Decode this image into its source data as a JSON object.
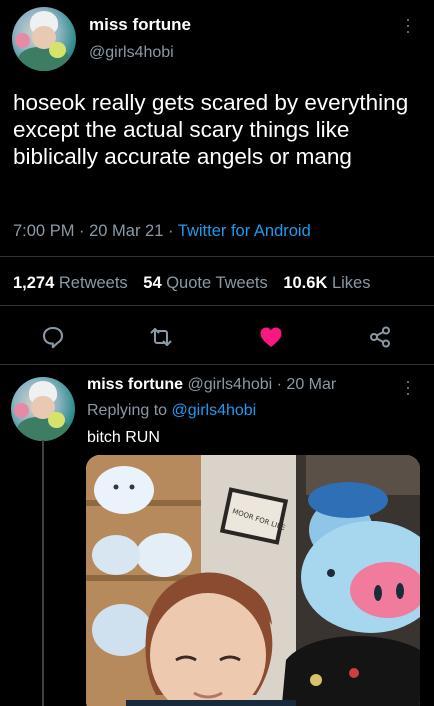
{
  "tweet": {
    "author_name": "miss fortune",
    "author_handle": "@girls4hobi",
    "text": "hoseok really gets scared by everything except the actual scary things like biblically accurate angels or mang",
    "time": "7:00 PM · 20 Mar 21 · ",
    "source": "Twitter for Android",
    "retweets_count": "1,274",
    "retweets_label": "Retweets",
    "quote_count": "54",
    "quote_label": "Quote Tweets",
    "likes_count": "10.6K",
    "likes_label": "Likes",
    "liked": true
  },
  "reply": {
    "author_name": "miss fortune",
    "author_handle": "@girls4hobi · 20 Mar",
    "replying_prefix": "Replying to ",
    "replying_to": "@girls4hobi",
    "text": "bitch RUN",
    "media_sign_text": "MOOR FOR LIFE"
  },
  "icons": [
    "more-icon",
    "reply-icon",
    "retweet-icon",
    "heart-icon",
    "share-icon"
  ],
  "colors": {
    "background": "#000000",
    "secondary_text": "#8b98a5",
    "link": "#1d9bf0",
    "like": "#f91880",
    "divider": "#2f3336"
  }
}
